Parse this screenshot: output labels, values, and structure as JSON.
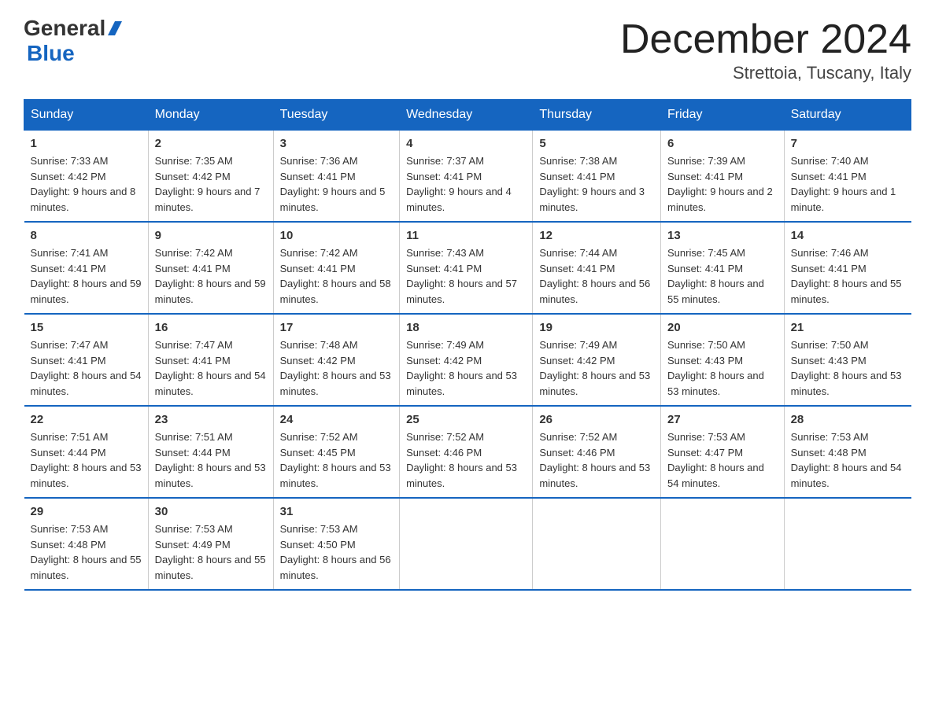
{
  "logo": {
    "text_general": "General",
    "text_blue": "Blue"
  },
  "title": "December 2024",
  "location": "Strettoia, Tuscany, Italy",
  "days_of_week": [
    "Sunday",
    "Monday",
    "Tuesday",
    "Wednesday",
    "Thursday",
    "Friday",
    "Saturday"
  ],
  "weeks": [
    [
      {
        "day": "1",
        "sunrise": "7:33 AM",
        "sunset": "4:42 PM",
        "daylight": "9 hours and 8 minutes."
      },
      {
        "day": "2",
        "sunrise": "7:35 AM",
        "sunset": "4:42 PM",
        "daylight": "9 hours and 7 minutes."
      },
      {
        "day": "3",
        "sunrise": "7:36 AM",
        "sunset": "4:41 PM",
        "daylight": "9 hours and 5 minutes."
      },
      {
        "day": "4",
        "sunrise": "7:37 AM",
        "sunset": "4:41 PM",
        "daylight": "9 hours and 4 minutes."
      },
      {
        "day": "5",
        "sunrise": "7:38 AM",
        "sunset": "4:41 PM",
        "daylight": "9 hours and 3 minutes."
      },
      {
        "day": "6",
        "sunrise": "7:39 AM",
        "sunset": "4:41 PM",
        "daylight": "9 hours and 2 minutes."
      },
      {
        "day": "7",
        "sunrise": "7:40 AM",
        "sunset": "4:41 PM",
        "daylight": "9 hours and 1 minute."
      }
    ],
    [
      {
        "day": "8",
        "sunrise": "7:41 AM",
        "sunset": "4:41 PM",
        "daylight": "8 hours and 59 minutes."
      },
      {
        "day": "9",
        "sunrise": "7:42 AM",
        "sunset": "4:41 PM",
        "daylight": "8 hours and 59 minutes."
      },
      {
        "day": "10",
        "sunrise": "7:42 AM",
        "sunset": "4:41 PM",
        "daylight": "8 hours and 58 minutes."
      },
      {
        "day": "11",
        "sunrise": "7:43 AM",
        "sunset": "4:41 PM",
        "daylight": "8 hours and 57 minutes."
      },
      {
        "day": "12",
        "sunrise": "7:44 AM",
        "sunset": "4:41 PM",
        "daylight": "8 hours and 56 minutes."
      },
      {
        "day": "13",
        "sunrise": "7:45 AM",
        "sunset": "4:41 PM",
        "daylight": "8 hours and 55 minutes."
      },
      {
        "day": "14",
        "sunrise": "7:46 AM",
        "sunset": "4:41 PM",
        "daylight": "8 hours and 55 minutes."
      }
    ],
    [
      {
        "day": "15",
        "sunrise": "7:47 AM",
        "sunset": "4:41 PM",
        "daylight": "8 hours and 54 minutes."
      },
      {
        "day": "16",
        "sunrise": "7:47 AM",
        "sunset": "4:41 PM",
        "daylight": "8 hours and 54 minutes."
      },
      {
        "day": "17",
        "sunrise": "7:48 AM",
        "sunset": "4:42 PM",
        "daylight": "8 hours and 53 minutes."
      },
      {
        "day": "18",
        "sunrise": "7:49 AM",
        "sunset": "4:42 PM",
        "daylight": "8 hours and 53 minutes."
      },
      {
        "day": "19",
        "sunrise": "7:49 AM",
        "sunset": "4:42 PM",
        "daylight": "8 hours and 53 minutes."
      },
      {
        "day": "20",
        "sunrise": "7:50 AM",
        "sunset": "4:43 PM",
        "daylight": "8 hours and 53 minutes."
      },
      {
        "day": "21",
        "sunrise": "7:50 AM",
        "sunset": "4:43 PM",
        "daylight": "8 hours and 53 minutes."
      }
    ],
    [
      {
        "day": "22",
        "sunrise": "7:51 AM",
        "sunset": "4:44 PM",
        "daylight": "8 hours and 53 minutes."
      },
      {
        "day": "23",
        "sunrise": "7:51 AM",
        "sunset": "4:44 PM",
        "daylight": "8 hours and 53 minutes."
      },
      {
        "day": "24",
        "sunrise": "7:52 AM",
        "sunset": "4:45 PM",
        "daylight": "8 hours and 53 minutes."
      },
      {
        "day": "25",
        "sunrise": "7:52 AM",
        "sunset": "4:46 PM",
        "daylight": "8 hours and 53 minutes."
      },
      {
        "day": "26",
        "sunrise": "7:52 AM",
        "sunset": "4:46 PM",
        "daylight": "8 hours and 53 minutes."
      },
      {
        "day": "27",
        "sunrise": "7:53 AM",
        "sunset": "4:47 PM",
        "daylight": "8 hours and 54 minutes."
      },
      {
        "day": "28",
        "sunrise": "7:53 AM",
        "sunset": "4:48 PM",
        "daylight": "8 hours and 54 minutes."
      }
    ],
    [
      {
        "day": "29",
        "sunrise": "7:53 AM",
        "sunset": "4:48 PM",
        "daylight": "8 hours and 55 minutes."
      },
      {
        "day": "30",
        "sunrise": "7:53 AM",
        "sunset": "4:49 PM",
        "daylight": "8 hours and 55 minutes."
      },
      {
        "day": "31",
        "sunrise": "7:53 AM",
        "sunset": "4:50 PM",
        "daylight": "8 hours and 56 minutes."
      },
      null,
      null,
      null,
      null
    ]
  ]
}
